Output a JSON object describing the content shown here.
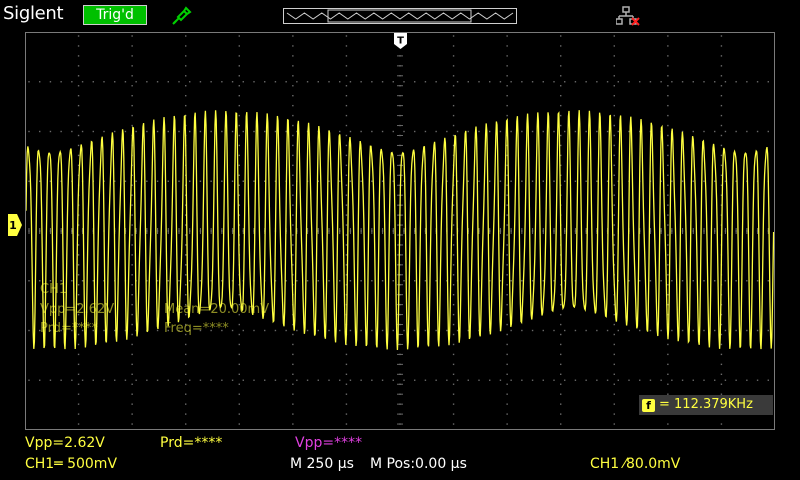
{
  "header": {
    "brand": "Siglent",
    "trigger_status": "Trig'd",
    "icons": {
      "probe": "probe-icon",
      "usb": "usb-disconnected-icon",
      "timebase": "timebase-overview-icon"
    }
  },
  "colors": {
    "ch1": "#ffff40",
    "math": "#e040e0",
    "trig_ok": "#00c000",
    "grid": "#7a7a7a"
  },
  "markers": {
    "trigger_position": "T",
    "channel_ref": "1"
  },
  "overlay_measure": {
    "channel": "CH1",
    "vpp": "Vpp=2.62V",
    "mean": "Mean=20.00mV",
    "prd": "Prd=****",
    "freq": "Freq=****"
  },
  "freq_counter": {
    "badge": "f",
    "value": "= 112.379KHz"
  },
  "bottom": {
    "vpp": "Vpp=2.62V",
    "prd": "Prd=****",
    "vpp_math": "Vpp=****",
    "ch1_scale": "CH1═ 500mV",
    "timebase": "M 250 µs",
    "mpos": "M Pos:0.00 µs",
    "trigger": "CH1 ⁄80.0mV"
  }
}
